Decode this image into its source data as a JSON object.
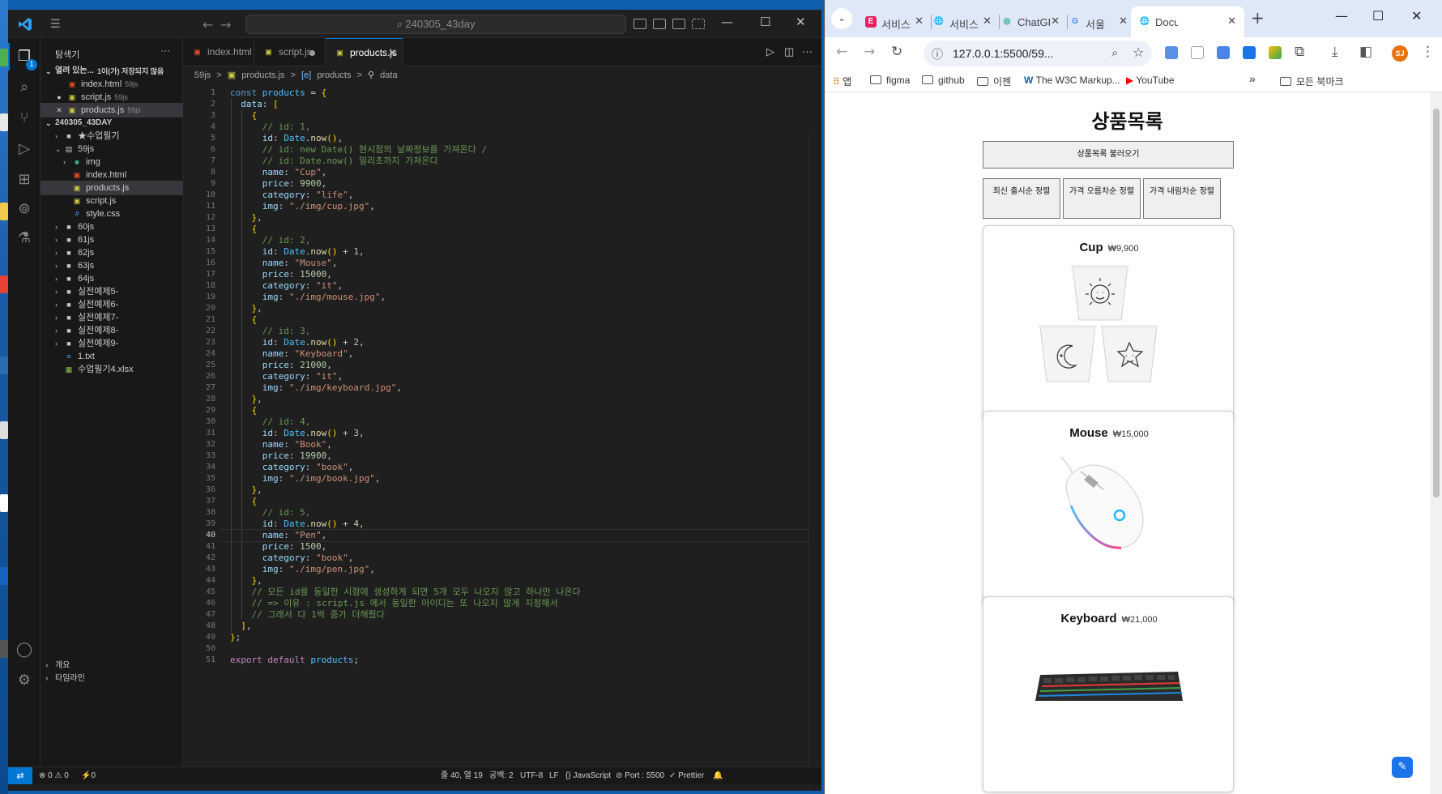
{
  "vscode": {
    "search_text": "⌕ 240305_43day",
    "sidebar": {
      "title": "탐색기",
      "open_editors_label": "열려 있는...",
      "open_editors_hint": "1이(가) 저장되지 않음",
      "open_editors": [
        {
          "name": "index.html",
          "hint": "59js"
        },
        {
          "name": "script.js",
          "hint": "59js"
        },
        {
          "name": "products.js",
          "hint": "59js"
        }
      ],
      "workspace_label": "240305_43DAY",
      "tree": [
        {
          "name": "★수업필기",
          "type": "folder",
          "open": false
        },
        {
          "name": "59js",
          "type": "folder",
          "open": true
        },
        {
          "name": "img",
          "type": "folder",
          "open": false
        },
        {
          "name": "index.html",
          "type": "html"
        },
        {
          "name": "products.js",
          "type": "js"
        },
        {
          "name": "script.js",
          "type": "js"
        },
        {
          "name": "style.css",
          "type": "css"
        },
        {
          "name": "60js",
          "type": "folder",
          "open": false
        },
        {
          "name": "61js",
          "type": "folder",
          "open": false
        },
        {
          "name": "62js",
          "type": "folder",
          "open": false
        },
        {
          "name": "63js",
          "type": "folder",
          "open": false
        },
        {
          "name": "64js",
          "type": "folder",
          "open": false
        },
        {
          "name": "실전예제5-",
          "type": "folder",
          "open": false
        },
        {
          "name": "실전예제6-",
          "type": "folder",
          "open": false
        },
        {
          "name": "실전예제7-",
          "type": "folder",
          "open": false
        },
        {
          "name": "실전예제8-",
          "type": "folder",
          "open": false
        },
        {
          "name": "실전예제9-",
          "type": "folder",
          "open": false
        },
        {
          "name": "1.txt",
          "type": "txt"
        },
        {
          "name": "수업필기4.xlsx",
          "type": "xlsx"
        }
      ],
      "outline_label": "개요",
      "timeline_label": "타임라인"
    },
    "tabs": [
      {
        "label": "index.html",
        "icon": "html-icon"
      },
      {
        "label": "script.js",
        "icon": "js-icon"
      },
      {
        "label": "products.js",
        "icon": "js-icon"
      }
    ],
    "breadcrumb": [
      "59js",
      ">",
      "products.js",
      ">",
      "products",
      ">",
      "data"
    ],
    "code_lines": [
      "const products = {",
      "  data: [",
      "    {",
      "      // id: 1,",
      "      id: Date.now(),",
      "      // id: new Date() 현시점의 날짜정보를 가져온다 /",
      "      // id: Date.now() 밀리초까지 가져온다",
      "      name: \"Cup\",",
      "      price: 9900,",
      "      category: \"life\",",
      "      img: \"./img/cup.jpg\",",
      "    },",
      "    {",
      "      // id: 2,",
      "      id: Date.now() + 1,",
      "      name: \"Mouse\",",
      "      price: 15000,",
      "      category: \"it\",",
      "      img: \"./img/mouse.jpg\",",
      "    },",
      "    {",
      "      // id: 3,",
      "      id: Date.now() + 2,",
      "      name: \"Keyboard\",",
      "      price: 21000,",
      "      category: \"it\",",
      "      img: \"./img/keyboard.jpg\",",
      "    },",
      "    {",
      "      // id: 4,",
      "      id: Date.now() + 3,",
      "      name: \"Book\",",
      "      price: 19900,",
      "      category: \"book\",",
      "      img: \"./img/book.jpg\",",
      "    },",
      "    {",
      "      // id: 5,",
      "      id: Date.now() + 4,",
      "      name: \"Pen\",",
      "      price: 1500,",
      "      category: \"book\",",
      "      img: \"./img/pen.jpg\",",
      "    },",
      "    // 모든 id를 동일한 시점에 생성하게 되면 5개 모두 나오지 않고 하나만 나온다",
      "    // => 이유 : script.js 에서 동일한 아이디는 또 나오지 않게 지정해서",
      "    // 그래서 다 1씩 증가 더해줬다",
      "  ],",
      "};",
      "",
      "export default products;"
    ],
    "current_line": 40,
    "status": {
      "errors": "⊗ 0 ⚠ 0",
      "ports": "⚡0",
      "position": "줄 40, 열 19",
      "spaces": "공백: 2",
      "encoding": "UTF-8",
      "eol": "LF",
      "language": "{} JavaScript",
      "port": "⊘ Port : 5500",
      "prettier": "✓ Prettier"
    }
  },
  "chrome": {
    "tabs": [
      {
        "title": "서비스",
        "favicon": "E",
        "color": "#e91e63"
      },
      {
        "title": "서비스",
        "favicon": "🌐",
        "color": "#5f6368"
      },
      {
        "title": "ChatGPT",
        "favicon": "◎",
        "color": "#10a37f"
      },
      {
        "title": "서울",
        "favicon": "G",
        "color": "#4285f4"
      },
      {
        "title": "Document",
        "favicon": "🌐",
        "color": "#5f6368"
      }
    ],
    "url": "127.0.0.1:5500/59...",
    "bookmarks": [
      "앱",
      "figma",
      "github",
      "이젠",
      "The W3C Markup...",
      "YouTube"
    ],
    "bookmarks_more": "»",
    "all_bookmarks": "모든 북마크",
    "profile_initials": "SJ"
  },
  "page": {
    "title": "상품목록",
    "load_button": "상품목록 불러오기",
    "sort_buttons": [
      "최신 출시순 정렬",
      "가격 오름차순 정렬",
      "가격 내림차순 정렬"
    ],
    "products": [
      {
        "name": "Cup",
        "price": "₩9,900"
      },
      {
        "name": "Mouse",
        "price": "₩15,000"
      },
      {
        "name": "Keyboard",
        "price": "₩21,000"
      }
    ]
  }
}
